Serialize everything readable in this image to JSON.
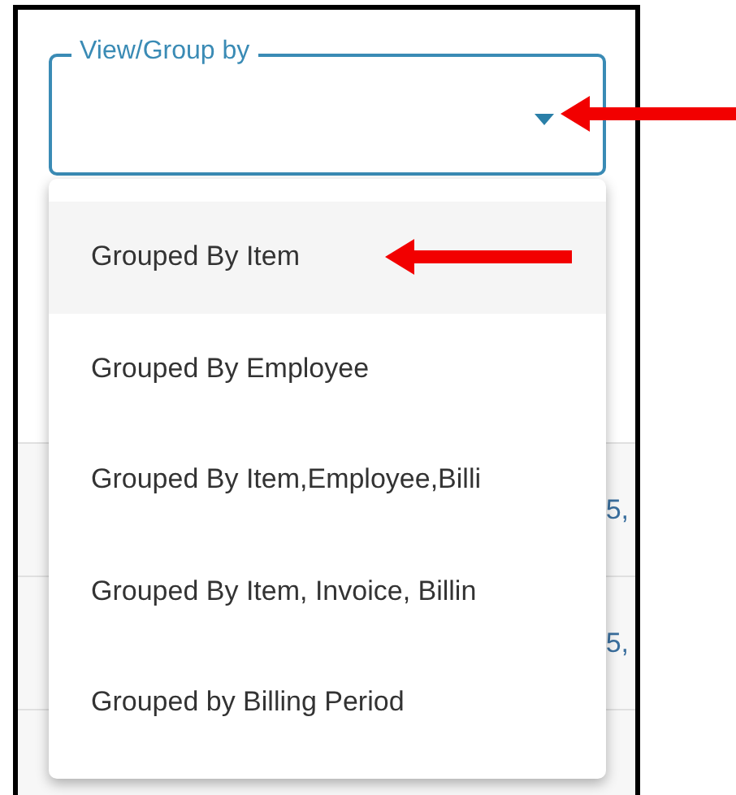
{
  "field": {
    "label": "View/Group by",
    "expanded": true
  },
  "menu": {
    "items": [
      {
        "label": "Grouped By Item",
        "selected": true
      },
      {
        "label": "Grouped By Employee",
        "selected": false
      },
      {
        "label": "Grouped By Item,Employee,Billi",
        "selected": false
      },
      {
        "label": "Grouped By Item, Invoice, Billin",
        "selected": false
      },
      {
        "label": "Grouped by Billing Period",
        "selected": false
      }
    ]
  },
  "background_rows": [
    {
      "text": "5,"
    },
    {
      "text": "5,"
    }
  ]
}
